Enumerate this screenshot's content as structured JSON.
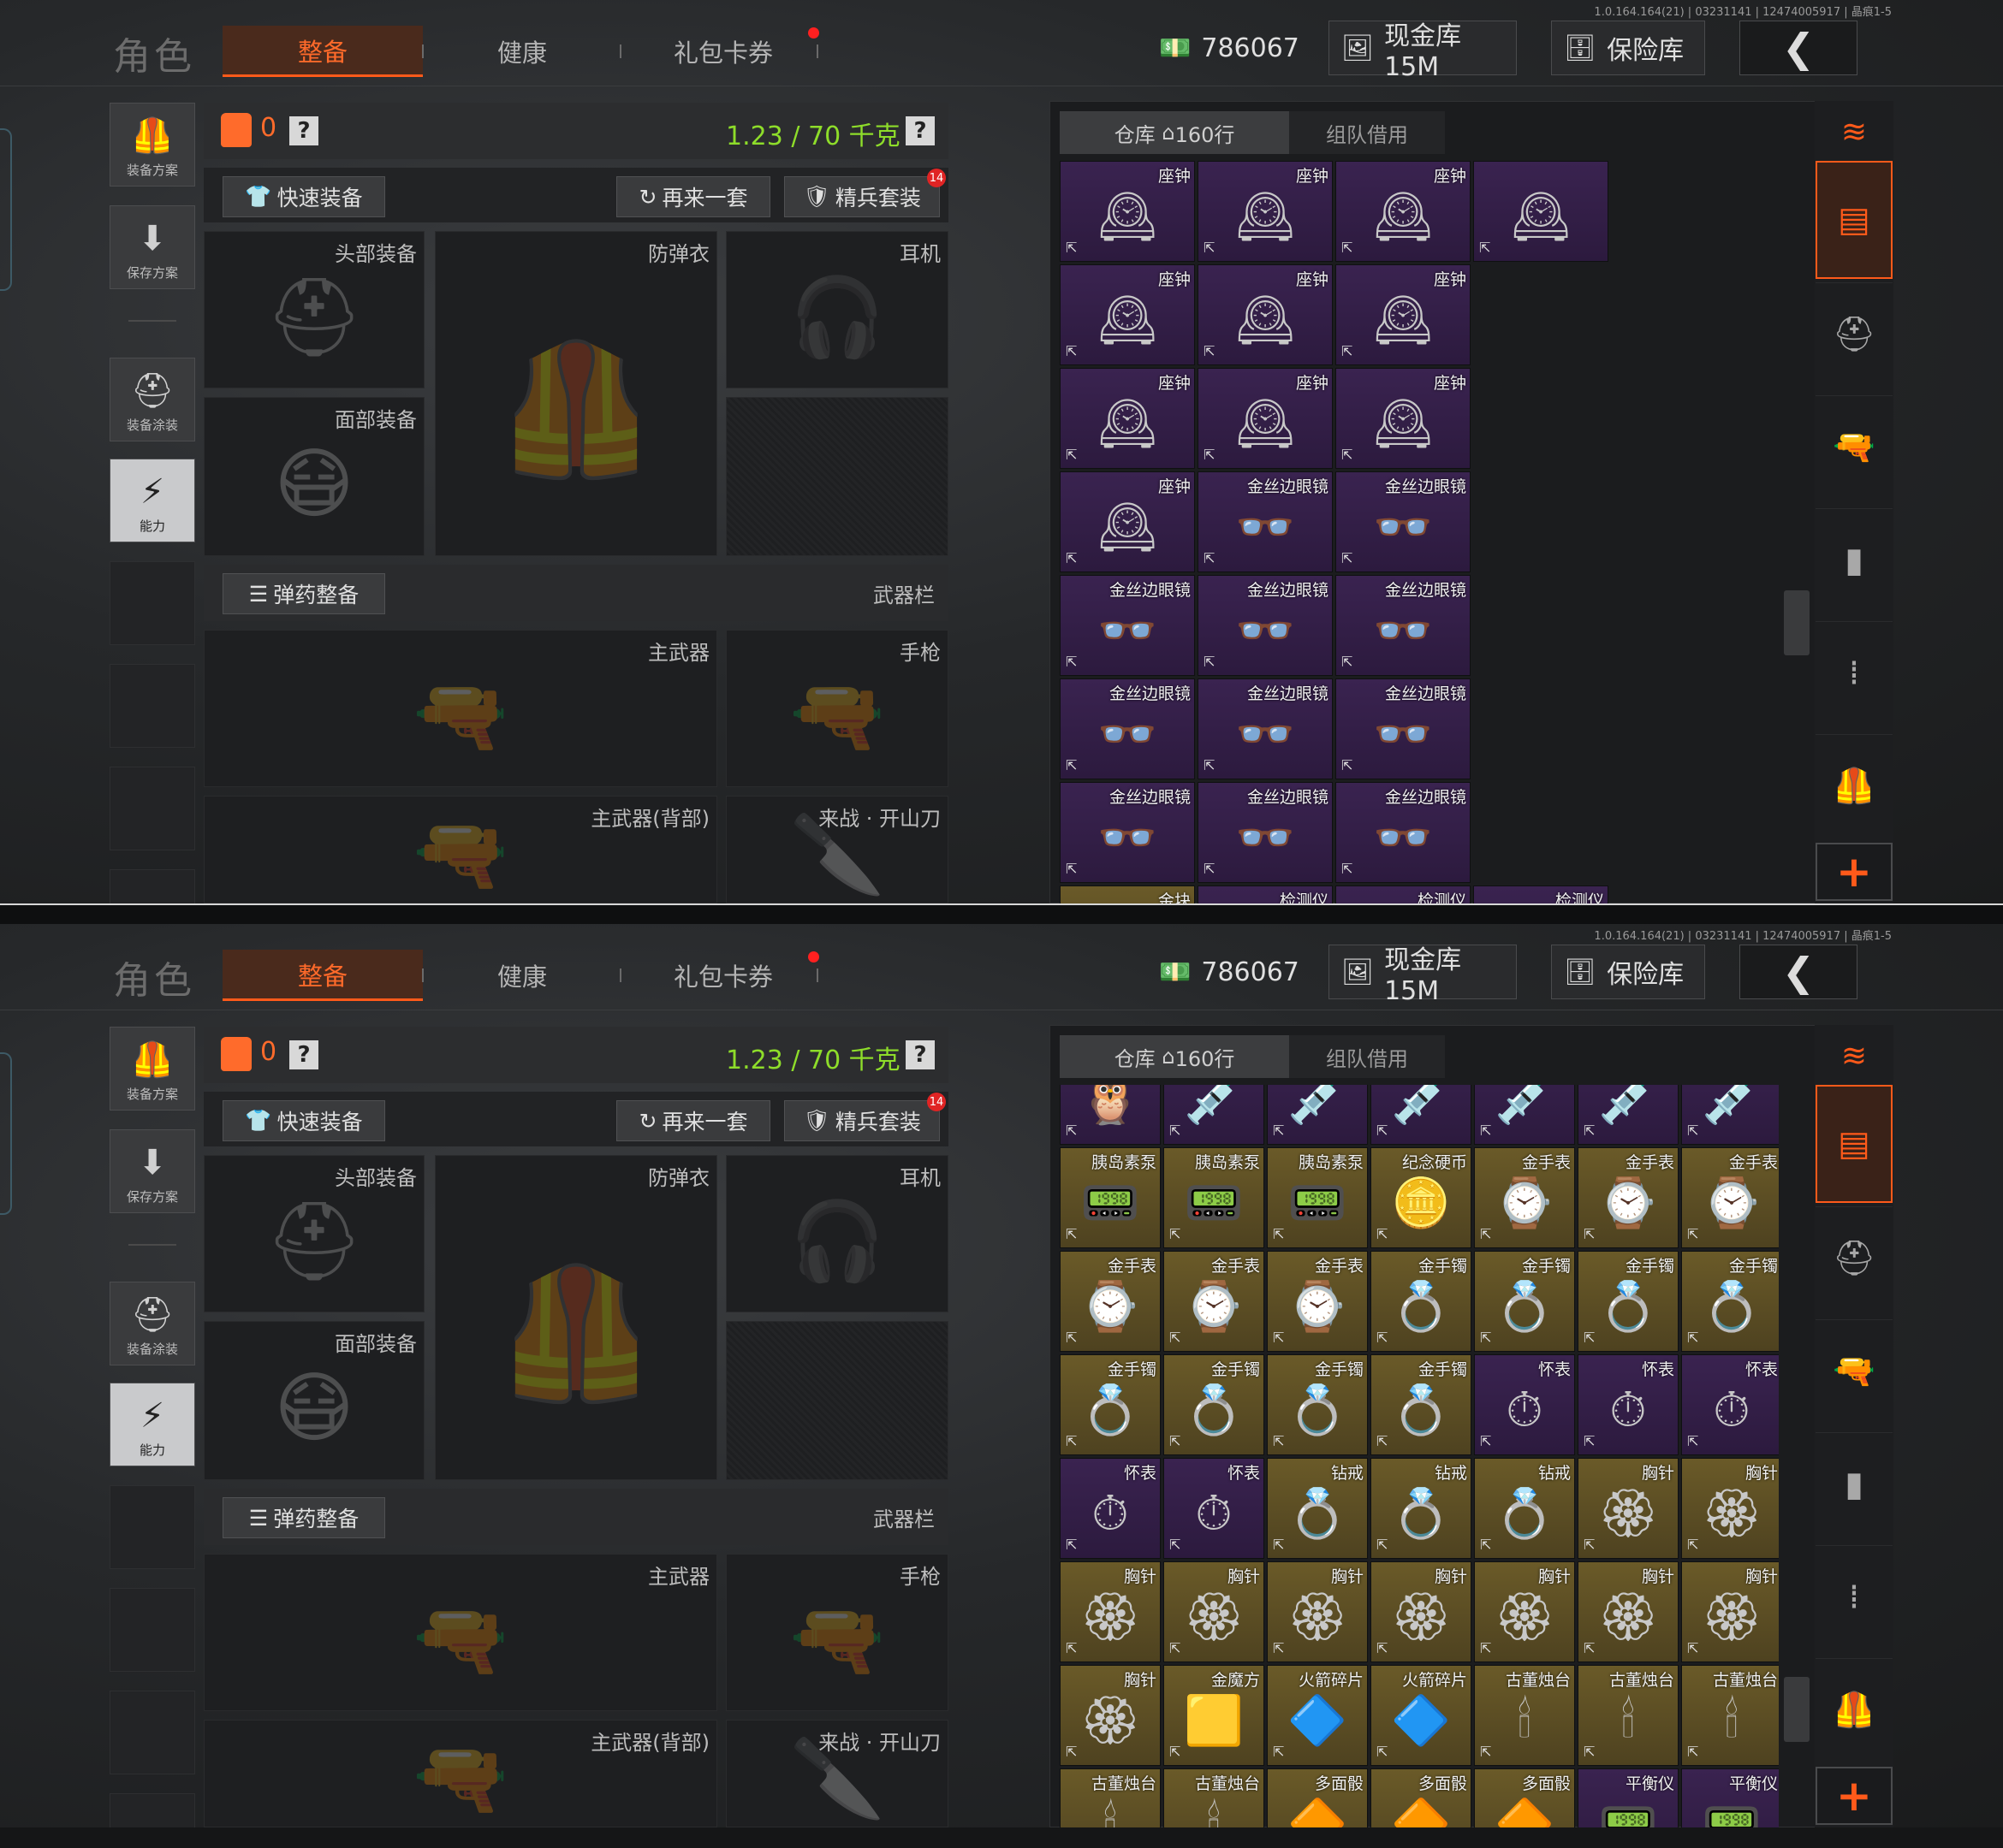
{
  "version": "1.0.164.164(21) | 03231141 | 12474005917 | 晶痕1-5",
  "header": {
    "title": "角色",
    "tabs": [
      "整备",
      "健康",
      "礼包卡券"
    ],
    "money": "786067",
    "cash_store": "现金库 15M",
    "safe_box": "保险库"
  },
  "sidebar": {
    "items": [
      {
        "label": "装备方案",
        "icon": "vest-icon"
      },
      {
        "label": "保存方案",
        "icon": "download-icon"
      },
      {
        "label": "装备涂装",
        "icon": "helmet-paint-icon"
      },
      {
        "label": "能力",
        "icon": "lightning-icon"
      }
    ]
  },
  "loadout": {
    "armor_count": "0",
    "weight": "1.23 / 70 千克",
    "quick_equip": "快速装备",
    "again": "再来一套",
    "elite_kit": "精兵套装",
    "elite_badge": "14",
    "slots": {
      "head": "头部装备",
      "armor": "防弹衣",
      "headset": "耳机",
      "face": "面部装备",
      "ammo": "弹药整备",
      "weapon_bar": "武器栏",
      "primary": "主武器",
      "pistol": "手枪",
      "primary_back": "主武器(背部)",
      "melee": "来战 · 开山刀"
    }
  },
  "inventory": {
    "tab_storage": "仓库",
    "rows": "160行",
    "tab_team": "组队借用",
    "colors": {
      "purple": "#3a2350",
      "gold": "#6a5a28",
      "accent": "#ff5a1a"
    },
    "panel1": [
      {
        "name": "座钟",
        "tier": "purple",
        "icon": "clock"
      },
      {
        "name": "座钟",
        "tier": "purple",
        "icon": "clock"
      },
      {
        "name": "座钟",
        "tier": "purple",
        "icon": "clock"
      },
      {
        "name": "",
        "tier": "purple",
        "icon": "clock"
      },
      {
        "name": "座钟",
        "tier": "purple",
        "icon": "clock"
      },
      {
        "name": "座钟",
        "tier": "purple",
        "icon": "clock"
      },
      {
        "name": "座钟",
        "tier": "purple",
        "icon": "clock"
      },
      {
        "name": "座钟",
        "tier": "purple",
        "icon": "clock",
        "tall": true
      },
      {
        "name": "座钟",
        "tier": "purple",
        "icon": "clock"
      },
      {
        "name": "座钟",
        "tier": "purple",
        "icon": "clock"
      },
      {
        "name": "座钟",
        "tier": "purple",
        "icon": "clock"
      },
      {
        "name": "座钟",
        "tier": "purple",
        "icon": "clock"
      },
      {
        "name": "金丝边眼镜",
        "tier": "purple",
        "icon": "glasses"
      },
      {
        "name": "金丝边眼镜",
        "tier": "purple",
        "icon": "glasses"
      },
      {
        "name": "金丝边眼镜",
        "tier": "purple",
        "icon": "glasses",
        "tall": true
      },
      {
        "name": "金丝边眼镜",
        "tier": "purple",
        "icon": "glasses"
      },
      {
        "name": "金丝边眼镜",
        "tier": "purple",
        "icon": "glasses"
      },
      {
        "name": "金丝边眼镜",
        "tier": "purple",
        "icon": "glasses"
      },
      {
        "name": "金丝边眼镜",
        "tier": "purple",
        "icon": "glasses"
      },
      {
        "name": "金丝边眼镜",
        "tier": "purple",
        "icon": "glasses"
      },
      {
        "name": "金丝边眼镜",
        "tier": "purple",
        "icon": "glasses"
      },
      {
        "name": "金丝边眼镜",
        "tier": "purple",
        "icon": "glasses",
        "tall": true
      },
      {
        "name": "金丝边眼镜",
        "tier": "purple",
        "icon": "glasses"
      },
      {
        "name": "金丝边眼镜",
        "tier": "purple",
        "icon": "glasses"
      },
      {
        "name": "金丝边眼镜",
        "tier": "purple",
        "icon": "glasses"
      },
      {
        "name": "金块",
        "tier": "gold",
        "icon": "gold"
      },
      {
        "name": "检测仪",
        "tier": "purple",
        "icon": "device"
      },
      {
        "name": "检测仪",
        "tier": "purple",
        "icon": "device"
      },
      {
        "name": "检测仪",
        "tier": "purple",
        "icon": "device"
      }
    ],
    "panel2": [
      {
        "name": "",
        "tier": "purple",
        "icon": "owl"
      },
      {
        "name": "",
        "tier": "purple",
        "icon": "syringe"
      },
      {
        "name": "",
        "tier": "purple",
        "icon": "syringe"
      },
      {
        "name": "",
        "tier": "purple",
        "icon": "syringe"
      },
      {
        "name": "",
        "tier": "purple",
        "icon": "syringe"
      },
      {
        "name": "",
        "tier": "purple",
        "icon": "syringe"
      },
      {
        "name": "",
        "tier": "purple",
        "icon": "syringe"
      },
      {
        "name": "胰岛素泵",
        "tier": "gold",
        "icon": "pump"
      },
      {
        "name": "胰岛素泵",
        "tier": "gold",
        "icon": "pump"
      },
      {
        "name": "胰岛素泵",
        "tier": "gold",
        "icon": "pump"
      },
      {
        "name": "纪念硬币",
        "tier": "gold",
        "icon": "coin"
      },
      {
        "name": "金手表",
        "tier": "gold",
        "icon": "watch"
      },
      {
        "name": "金手表",
        "tier": "gold",
        "icon": "watch"
      },
      {
        "name": "金手表",
        "tier": "gold",
        "icon": "watch"
      },
      {
        "name": "金手表",
        "tier": "gold",
        "icon": "watch"
      },
      {
        "name": "金手表",
        "tier": "gold",
        "icon": "watch"
      },
      {
        "name": "金手表",
        "tier": "gold",
        "icon": "watch"
      },
      {
        "name": "金手镯",
        "tier": "gold",
        "icon": "bracelet"
      },
      {
        "name": "金手镯",
        "tier": "gold",
        "icon": "bracelet"
      },
      {
        "name": "金手镯",
        "tier": "gold",
        "icon": "bracelet"
      },
      {
        "name": "金手镯",
        "tier": "gold",
        "icon": "bracelet"
      },
      {
        "name": "金手镯",
        "tier": "gold",
        "icon": "bracelet"
      },
      {
        "name": "金手镯",
        "tier": "gold",
        "icon": "bracelet"
      },
      {
        "name": "金手镯",
        "tier": "gold",
        "icon": "bracelet"
      },
      {
        "name": "金手镯",
        "tier": "gold",
        "icon": "bracelet"
      },
      {
        "name": "怀表",
        "tier": "purple",
        "icon": "pocketwatch"
      },
      {
        "name": "怀表",
        "tier": "purple",
        "icon": "pocketwatch"
      },
      {
        "name": "怀表",
        "tier": "purple",
        "icon": "pocketwatch"
      },
      {
        "name": "怀表",
        "tier": "purple",
        "icon": "pocketwatch"
      },
      {
        "name": "怀表",
        "tier": "purple",
        "icon": "pocketwatch"
      },
      {
        "name": "钻戒",
        "tier": "gold",
        "icon": "ring"
      },
      {
        "name": "钻戒",
        "tier": "gold",
        "icon": "ring"
      },
      {
        "name": "钻戒",
        "tier": "gold",
        "icon": "ring"
      },
      {
        "name": "胸针",
        "tier": "gold",
        "icon": "brooch"
      },
      {
        "name": "胸针",
        "tier": "gold",
        "icon": "brooch"
      },
      {
        "name": "胸针",
        "tier": "gold",
        "icon": "brooch"
      },
      {
        "name": "胸针",
        "tier": "gold",
        "icon": "brooch"
      },
      {
        "name": "胸针",
        "tier": "gold",
        "icon": "brooch"
      },
      {
        "name": "胸针",
        "tier": "gold",
        "icon": "brooch"
      },
      {
        "name": "胸针",
        "tier": "gold",
        "icon": "brooch"
      },
      {
        "name": "胸针",
        "tier": "gold",
        "icon": "brooch"
      },
      {
        "name": "胸针",
        "tier": "gold",
        "icon": "brooch"
      },
      {
        "name": "胸针",
        "tier": "gold",
        "icon": "brooch"
      },
      {
        "name": "金魔方",
        "tier": "gold",
        "icon": "cube"
      },
      {
        "name": "火箭碎片",
        "tier": "gold",
        "icon": "shard"
      },
      {
        "name": "火箭碎片",
        "tier": "gold",
        "icon": "shard"
      },
      {
        "name": "古董烛台",
        "tier": "gold",
        "icon": "candle"
      },
      {
        "name": "古董烛台",
        "tier": "gold",
        "icon": "candle"
      },
      {
        "name": "古董烛台",
        "tier": "gold",
        "icon": "candle"
      },
      {
        "name": "古董烛台",
        "tier": "gold",
        "icon": "candle"
      },
      {
        "name": "古董烛台",
        "tier": "gold",
        "icon": "candle"
      },
      {
        "name": "多面骰",
        "tier": "gold",
        "icon": "dice"
      },
      {
        "name": "多面骰",
        "tier": "gold",
        "icon": "dice"
      },
      {
        "name": "多面骰",
        "tier": "gold",
        "icon": "dice"
      },
      {
        "name": "平衡仪",
        "tier": "purple",
        "icon": "device"
      },
      {
        "name": "平衡仪",
        "tier": "purple",
        "icon": "device"
      }
    ]
  }
}
